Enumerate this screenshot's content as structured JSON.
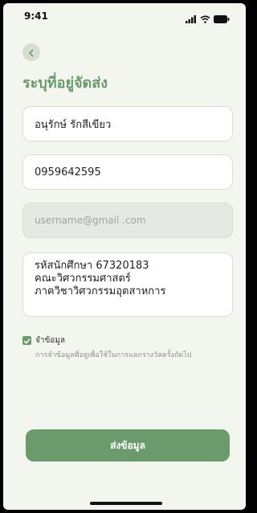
{
  "status_bar": {
    "time": "9:41"
  },
  "header": {
    "title": "ระบุที่อยู่จัดส่ง"
  },
  "form": {
    "name_value": "อนุรักษ์ รักสีเขียว",
    "phone_value": "0959642595",
    "email_placeholder": "username@gmail .com",
    "address_lines": [
      "รหัสนักศึกษา 67320183",
      "คณะวิศวกรรมศาสตร์",
      "ภาควิชาวิศวกรรมอุตสาหการ"
    ],
    "remember_label": "จำข้อมูล",
    "remember_description": "การจำข้อมูลที่อยู่เพื่อใช้ในการแลกรางวัลครั้งถัดไป",
    "remember_checked": true,
    "submit_label": "ส่งข้อมูล"
  },
  "colors": {
    "accent": "#6b9a6d",
    "background": "#f3f6ef"
  },
  "icons": {
    "back": "chevron-left-icon",
    "signal": "signal-icon",
    "wifi": "wifi-icon",
    "battery": "battery-icon",
    "check": "check-icon"
  }
}
